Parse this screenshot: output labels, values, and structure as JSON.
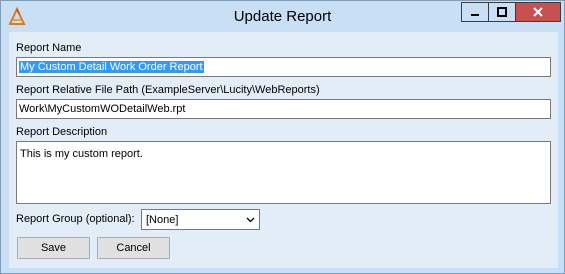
{
  "window": {
    "title": "Update Report",
    "icons": {
      "app": "app-logo-icon",
      "minimize": "minimize-icon",
      "maximize": "maximize-icon",
      "close": "close-icon"
    }
  },
  "form": {
    "report_name": {
      "label": "Report Name",
      "value": "My Custom Detail Work Order Report"
    },
    "file_path": {
      "label": "Report Relative File Path (ExampleServer\\Lucity\\WebReports)",
      "value": "Work\\MyCustomWODetailWeb.rpt"
    },
    "description": {
      "label": "Report Description",
      "value": "This is my custom report."
    },
    "group": {
      "label": "Report Group (optional):",
      "selected": "[None]",
      "icon": "chevron-down-icon"
    }
  },
  "buttons": {
    "save": "Save",
    "cancel": "Cancel"
  },
  "colors": {
    "frame": "#c9dff5",
    "client": "#e3edf8",
    "selection": "#3399ff",
    "close": "#c75050"
  }
}
